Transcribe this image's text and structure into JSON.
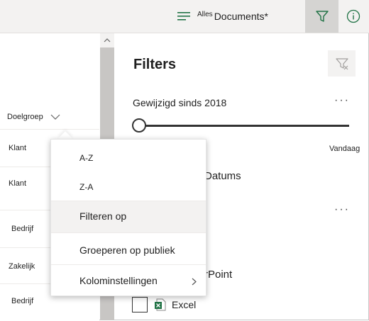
{
  "header": {
    "view_prefix": "Alles",
    "view_name": "Documents*"
  },
  "list": {
    "column_header": "Doelgroep",
    "rows": [
      "Klant",
      "Klant",
      "Bedrijf",
      "Zakelijk",
      "Bedrijf"
    ]
  },
  "menu": {
    "items": [
      "A-Z",
      "Z-A",
      "Filteren op",
      "Groeperen op publiek",
      "Kolominstellingen"
    ]
  },
  "filters": {
    "title": "Filters",
    "section_modified": "Gewijzigd sinds 2018",
    "slider_end_label": "Vandaag",
    "slider_value": 0,
    "dates_label_partial": "Datums",
    "powerpoint_partial": "rPoint",
    "excel_label": "Excel",
    "excel_checked": false
  },
  "colors": {
    "accent_green": "#217346",
    "topbar_bg": "#f3f2f1"
  }
}
